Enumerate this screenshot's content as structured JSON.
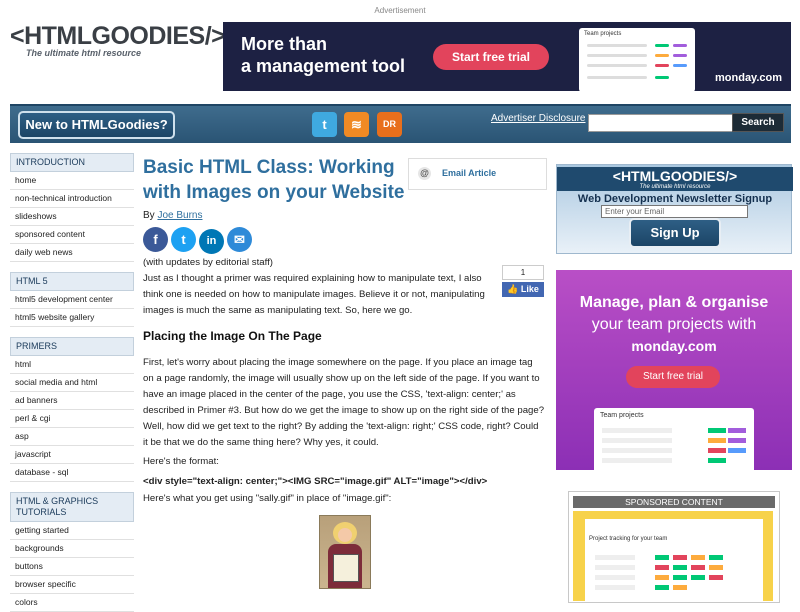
{
  "top": {
    "ad_label": "Advertisement",
    "logo_text": "<HTMLGOODIES/>",
    "logo_tagline": "The ultimate html resource",
    "ad_line1": "More than",
    "ad_line2": "a management tool",
    "ad_cta": "Start free trial",
    "ad_mini_title": "Team projects",
    "ad_brand": "monday.com"
  },
  "navbar": {
    "new_button": "New to HTMLGoodies?",
    "social_icons": [
      "twitter-icon",
      "rss-icon",
      "dr-icon"
    ],
    "advertiser_disclosure": "Advertiser Disclosure",
    "search_placeholder": "",
    "search_button": "Search"
  },
  "leftnav": {
    "sections": [
      {
        "title": "INTRODUCTION",
        "items": [
          "home",
          "non-technical introduction",
          "slideshows",
          "sponsored content",
          "daily web news"
        ]
      },
      {
        "title": "HTML 5",
        "items": [
          "html5 development center",
          "html5 website gallery"
        ]
      },
      {
        "title": "PRIMERS",
        "items": [
          "html",
          "social media and html",
          "ad banners",
          "perl & cgi",
          "asp",
          "javascript",
          "database - sql"
        ]
      },
      {
        "title": "HTML & GRAPHICS TUTORIALS",
        "items": [
          "getting started",
          "backgrounds",
          "buttons",
          "browser specific",
          "colors"
        ]
      }
    ]
  },
  "article": {
    "title": "Basic HTML Class: Working with Images on your Website",
    "by_label": "By",
    "author": "Joe Burns",
    "email_label": "Email Article",
    "share_icons": [
      "facebook-icon",
      "twitter-icon",
      "linkedin-icon",
      "email-icon"
    ],
    "like_count": "1",
    "like_label": "Like",
    "p1": "(with updates by editorial staff)",
    "p2": "Just as I thought a primer was required explaining how to manipulate text, I also think one is needed on how to manipulate images. Believe it or not, manipulating images is much the same as manipulating text. So, here we go.",
    "h_placing": "Placing the Image On The Page",
    "p3": "First, let's worry about placing the image somewhere on the page. If you place an image tag on a page randomly, the image will usually show up on the left side of the page. If you want to have an image placed in the center of the page, you use the CSS, 'text-align: center;' as described in Primer #3. But how do we get the image to show up on the right side of the page? Well, how did we get text to the right? By adding the 'text-align: right;' CSS code, right? Could it be that we do the same thing here? Why yes, it could.",
    "p4": "Here's the format:",
    "code": "<div style=\"text-align: center;\"><IMG SRC=\"image.gif\" ALT=\"image\"></div>",
    "p5": "Here's what you get using \"sally.gif\" in place of \"image.gif\":"
  },
  "right": {
    "nl_logo": "<HTMLGOODIES/>",
    "nl_tagline": "The ultimate html resource",
    "nl_heading": "Web Development Newsletter Signup",
    "nl_placeholder": "Enter your Email",
    "nl_button": "Sign Up",
    "ad_line1": "Manage, plan & organise",
    "ad_line2": "your team projects with",
    "ad_brand": "monday.com",
    "ad_cta": "Start free trial",
    "ad_mock_title": "Team projects",
    "sponsored_header": "SPONSORED CONTENT",
    "sponsored_title": "Project tracking for your team"
  },
  "colors": {
    "nav_blue": "#2f5a7a",
    "link_blue": "#2f6f9e",
    "monday_red": "#e2445c",
    "ad_purple": "#a23fbe"
  }
}
